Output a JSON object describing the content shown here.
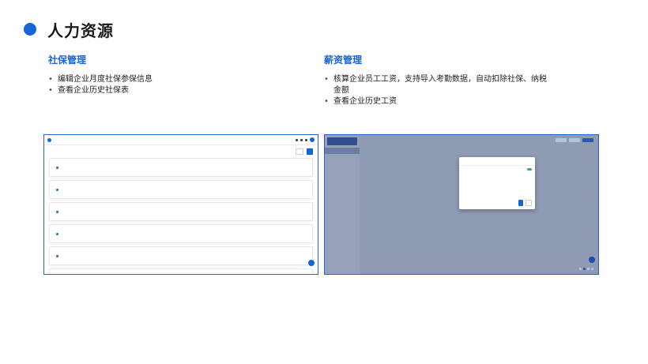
{
  "page": {
    "title": "人力资源"
  },
  "social": {
    "heading": "社保管理",
    "bullets": [
      "编辑企业月度社保参保信息",
      "查看企业历史社保表"
    ]
  },
  "salary": {
    "heading": "薪资管理",
    "bullets": [
      "核算企业员工工资，支持导入考勤数据，自动扣除社保、纳税金额",
      "查看企业历史工资"
    ]
  },
  "colors": {
    "accent": "#1565d8",
    "modal_toggle": "#2ab36a"
  }
}
